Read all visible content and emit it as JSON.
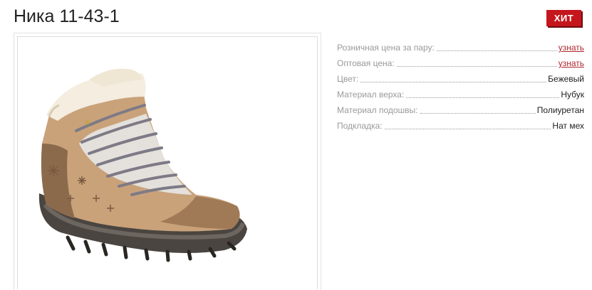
{
  "product": {
    "title": "Ника 11-43-1",
    "badge": "ХИТ",
    "image_alt": "shoe-image"
  },
  "specs": [
    {
      "label": "Розничная цена за пару:",
      "value": "узнать",
      "is_link": true
    },
    {
      "label": "Оптовая цена:",
      "value": "узнать",
      "is_link": true
    },
    {
      "label": "Цвет:",
      "value": "Бежевый",
      "is_link": false
    },
    {
      "label": "Материал верха:",
      "value": "Нубук",
      "is_link": false
    },
    {
      "label": "Материал подошвы:",
      "value": "Полиуретан",
      "is_link": false
    },
    {
      "label": "Подкладка:",
      "value": "Нат мех",
      "is_link": false
    }
  ],
  "colors": {
    "badge": "#c4161c",
    "link": "#b0282d",
    "label": "#9a9a9a",
    "text": "#222222"
  }
}
